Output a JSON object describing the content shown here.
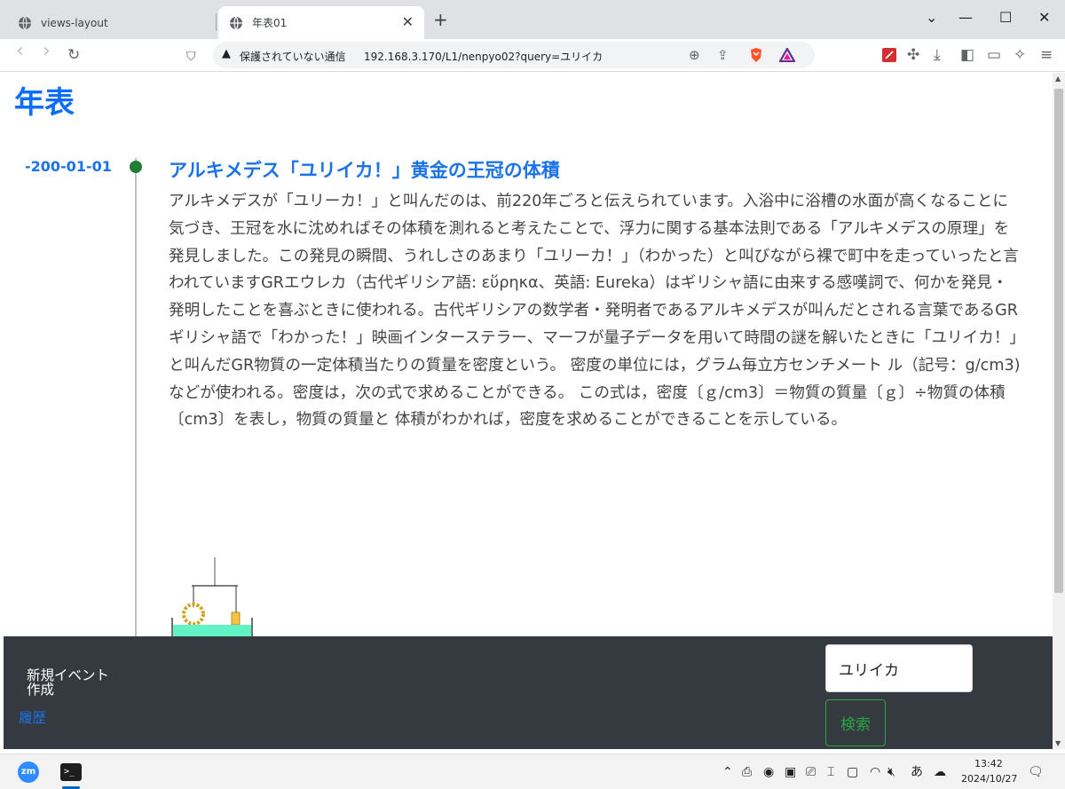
{
  "browser": {
    "tabs": [
      {
        "title": "views-layout",
        "active": false
      },
      {
        "title": "年表01",
        "active": true
      }
    ],
    "new_tab": "+",
    "window_controls": {
      "collapse": "⌄",
      "minimize": "—",
      "maximize": "☐",
      "close": "✕"
    },
    "toolbar": {
      "back": "‹",
      "forward": "›",
      "reload": "↻",
      "bookmark": "⛉",
      "security_warning_icon": "▲",
      "security_text": "保護されていない通信",
      "url": "192.168.3.170/L1/nenpyo02?query=ユリイカ"
    }
  },
  "page": {
    "title": "年表",
    "events": [
      {
        "date": "-200-01-01",
        "title": "アルキメデス「ユリイカ！」黄金の王冠の体積",
        "body": "アルキメデスが「ユリーカ！」と叫んだのは、前220年ごろと伝えられています。入浴中に浴槽の水面が高くなることに気づき、王冠を水に沈めればその体積を測れると考えたことで、浮力に関する基本法則である「アルキメデスの原理」を発見しました。この発見の瞬間、うれしさのあまり「ユリーカ！」（わかった）と叫びながら裸で町中を走っていったと言われていますGRエウレカ（古代ギリシア語: εὕρηκα、英語: Eureka）はギリシャ語に由来する感嘆詞で、何かを発見・発明したことを喜ぶときに使われる。古代ギリシアの数学者・発明者であるアルキメデスが叫んだとされる言葉であるGRギリシャ語で「わかった！」映画インターステラー、マーフが量子データを用いて時間の謎を解いたときに「ユリイカ！」と叫んだGR物質の一定体積当たりの質量を密度という。 密度の単位には，グラム毎立方センチメート ル（記号：g/cm3)などが使われる。密度は，次の式で求めることができる。 この式は，密度〔ｇ/cm3〕＝物質の質量〔ｇ〕÷物質の体積〔cm3〕を表し，物質の質量と 体積がわかれば，密度を求めることができることを示している。"
      }
    ]
  },
  "nav": {
    "new_event": "新規イベント作成",
    "history": "履歴",
    "search": {
      "value": "ユリイカ",
      "button": "検索"
    }
  },
  "taskbar": {
    "zoom_label": "zm",
    "terminal_label": ">_",
    "clock": {
      "time": "13:42",
      "date": "2024/10/27"
    }
  },
  "colors": {
    "accent": "#0d6efd",
    "link": "#1a73e8",
    "nav_bg": "#343a40",
    "search_button": "#28a745",
    "timeline_dot": "#1e7e34"
  }
}
